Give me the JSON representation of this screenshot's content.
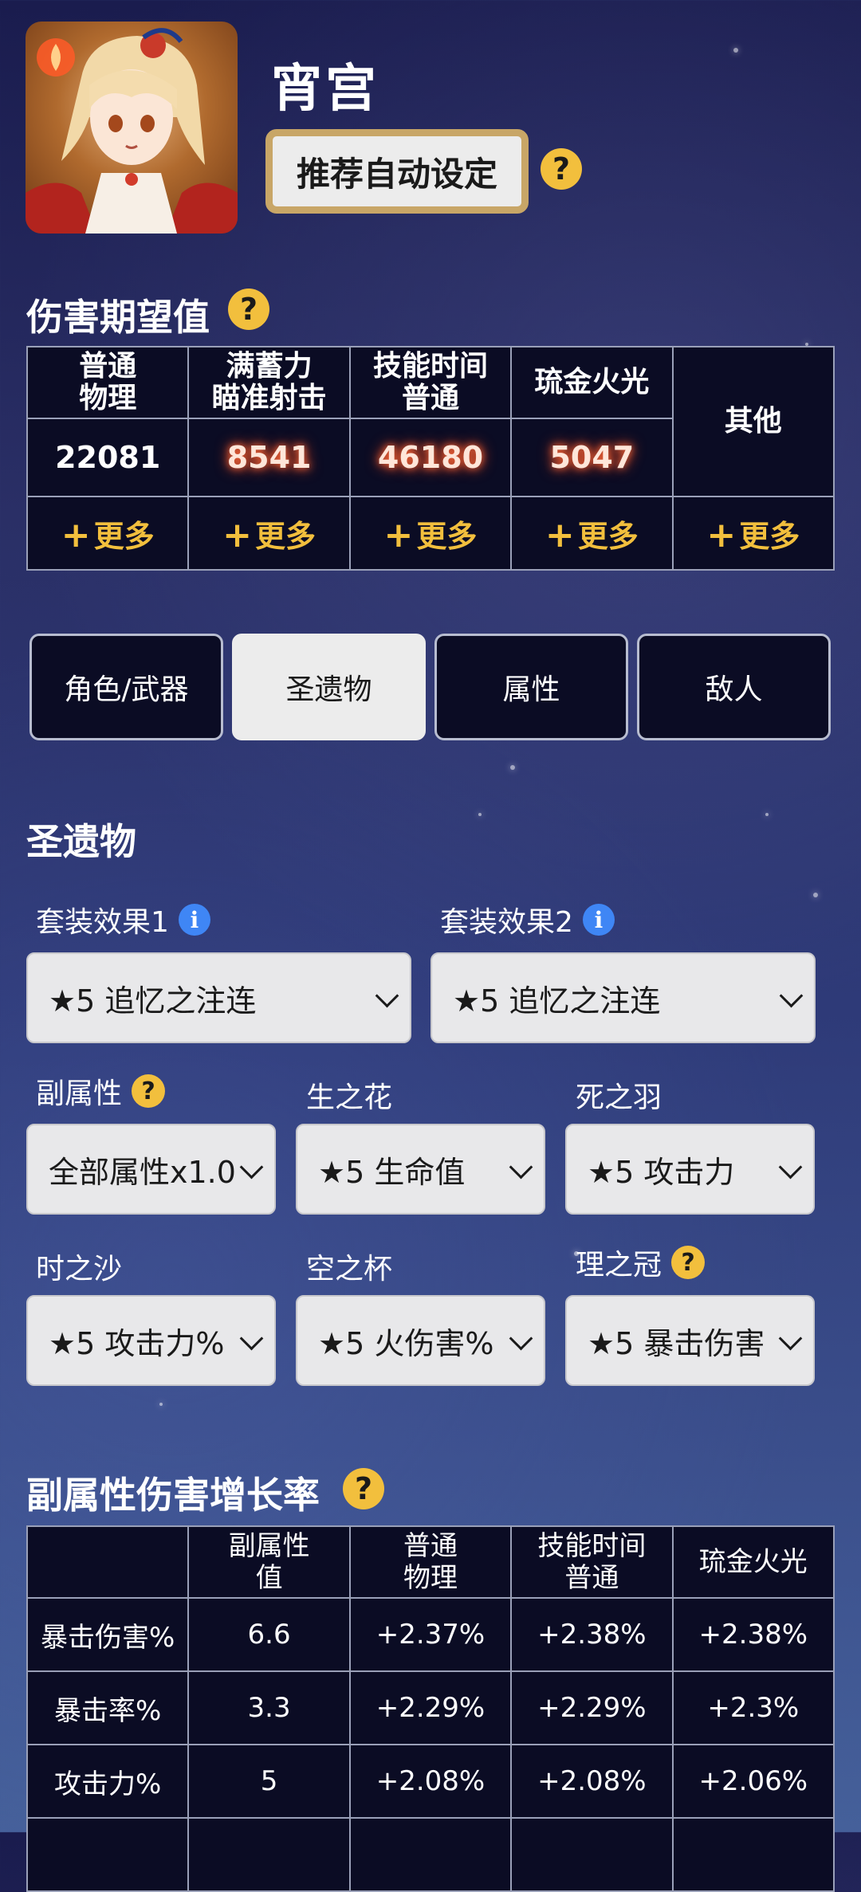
{
  "character": {
    "name": "宵宫",
    "auto_button": "推荐自动设定"
  },
  "icons": {
    "help": "question-icon",
    "info": "info-icon",
    "plus": "plus-icon",
    "chevron": "chevron-down-icon"
  },
  "colors": {
    "accent_gold": "#f2bf3d",
    "panel_dark": "#0b0c24",
    "info_blue": "#3f86f5",
    "button_border": "#c8a667"
  },
  "damage": {
    "title": "伤害期望值",
    "headers": [
      "普通\n物理",
      "满蓄力\n瞄准射击",
      "技能时间\n普通",
      "琉金火光"
    ],
    "other": "其他",
    "values": [
      "22081",
      "8541",
      "46180",
      "5047"
    ],
    "more": "更多"
  },
  "tabs": [
    {
      "label": "角色/武器"
    },
    {
      "label": "圣遗物"
    },
    {
      "label": "属性"
    },
    {
      "label": "敌人"
    }
  ],
  "artifacts": {
    "title": "圣遗物",
    "set1_label": "套装效果1",
    "set1_value": "★5 追忆之注连",
    "set2_label": "套装效果2",
    "set2_value": "★5 追忆之注连",
    "substat_label": "副属性",
    "substat_value": "全部属性x1.0",
    "flower_label": "生之花",
    "flower_value": "★5 生命值",
    "plume_label": "死之羽",
    "plume_value": "★5 攻击力",
    "sands_label": "时之沙",
    "sands_value": "★5 攻击力%",
    "goblet_label": "空之杯",
    "goblet_value": "★5 火伤害%",
    "circlet_label": "理之冠",
    "circlet_value": "★5 暴击伤害"
  },
  "substat_growth": {
    "title": "副属性伤害增长率",
    "headers": [
      "",
      "副属性\n值",
      "普通\n物理",
      "技能时间\n普通",
      "琉金火光"
    ],
    "rows": [
      [
        "暴击伤害%",
        "6.6",
        "+2.37%",
        "+2.38%",
        "+2.38%"
      ],
      [
        "暴击率%",
        "3.3",
        "+2.29%",
        "+2.29%",
        "+2.3%"
      ],
      [
        "攻击力%",
        "5",
        "+2.08%",
        "+2.08%",
        "+2.06%"
      ]
    ]
  }
}
